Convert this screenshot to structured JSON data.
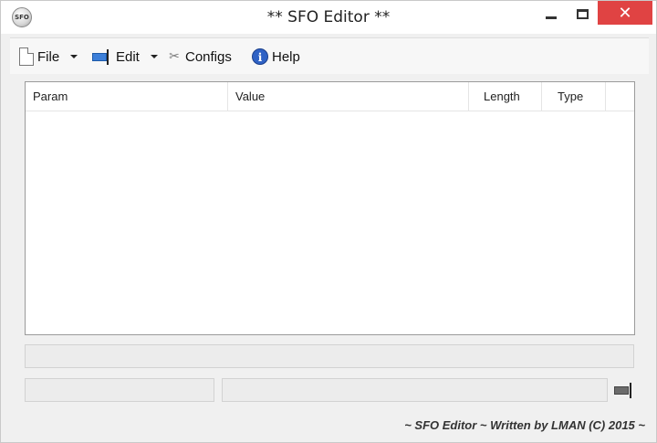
{
  "window": {
    "title": "** SFO Editor **",
    "app_icon_label": "SFO",
    "close_glyph": "✕"
  },
  "menu": {
    "file": {
      "label": "File",
      "icon": "file-icon"
    },
    "edit": {
      "label": "Edit",
      "icon": "edit-field-icon"
    },
    "configs": {
      "label": "Configs",
      "icon": "tools-icon",
      "glyph": "✂"
    },
    "help": {
      "label": "Help",
      "icon": "info-icon",
      "glyph": "i"
    }
  },
  "table": {
    "columns": [
      "Param",
      "Value",
      "Length",
      "Type"
    ],
    "rows": []
  },
  "fields": {
    "status_long": "",
    "status_left": "",
    "status_right": ""
  },
  "footer": {
    "text": "~ SFO Editor ~ Written by LMAN (C) 2015 ~"
  },
  "colors": {
    "close_button": "#e04343",
    "help_icon": "#2f62c5",
    "edit_icon": "#3c7fd9"
  }
}
